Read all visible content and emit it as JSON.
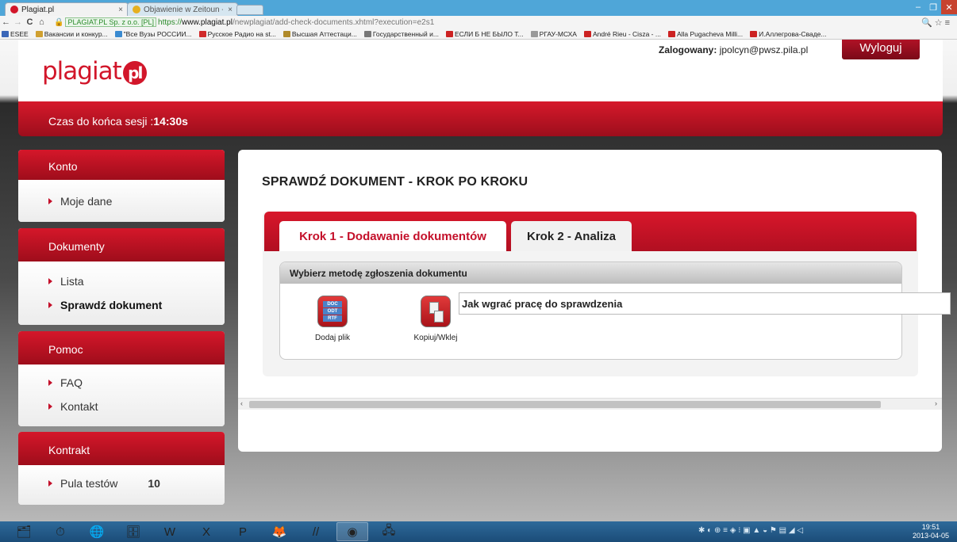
{
  "browser": {
    "tabs": [
      {
        "title": "Plagiat.pl",
        "close": "×"
      },
      {
        "title": "Objawienie w Zeitoun - St",
        "close": "×"
      }
    ],
    "window_controls": {
      "minimize": "–",
      "maximize": "❐",
      "close": "✕"
    },
    "nav": {
      "back": "←",
      "forward": "→",
      "reload": "C",
      "home": "⌂"
    },
    "address": {
      "org_label": "PLAGIAT.PL Sp. z o.o. [PL]",
      "scheme": "https://",
      "host": "www.plagiat.pl",
      "path": "/newplagiat/add-check-documents.xhtml?execution=e2s1"
    },
    "address_right": "🔍☆≡",
    "bookmarks": [
      {
        "label": "ESEE",
        "color": "#3a66b8"
      },
      {
        "label": "Вакансии и конкур...",
        "color": "#d0a030"
      },
      {
        "label": "\"Все Вузы РОССИИ...",
        "color": "#3a8ad0"
      },
      {
        "label": "Русское Радио на st...",
        "color": "#d02a2a"
      },
      {
        "label": "Высшая Аттестаци...",
        "color": "#b08a2a"
      },
      {
        "label": "Государственный и...",
        "color": "#777777"
      },
      {
        "label": "ЕСЛИ Б НЕ БЫЛО Т...",
        "color": "#cc2222"
      },
      {
        "label": "РГАУ-МСХА",
        "color": "#999999"
      },
      {
        "label": "André Rieu - Cisza - ...",
        "color": "#cc2222"
      },
      {
        "label": "Alla Pugacheva Milli...",
        "color": "#cc2222"
      },
      {
        "label": "И.Аллегрова-Сваде...",
        "color": "#cc2222"
      }
    ]
  },
  "header": {
    "logo_text": "plagiat",
    "logo_badge": "pl",
    "login_label": "Zalogowany:",
    "login_user": "jpolcyn@pwsz.pila.pl",
    "logout_label": "Wyloguj"
  },
  "session": {
    "label": "Czas do końca sesji :",
    "time": "14:30s"
  },
  "sidebar": {
    "konto": {
      "title": "Konto",
      "items": [
        "Moje dane"
      ]
    },
    "dokumenty": {
      "title": "Dokumenty",
      "items": [
        "Lista",
        "Sprawdź dokument"
      ]
    },
    "pomoc": {
      "title": "Pomoc",
      "items": [
        "FAQ",
        "Kontakt"
      ]
    },
    "kontrakt": {
      "title": "Kontrakt",
      "pool_label": "Pula testów",
      "pool_count": "10"
    }
  },
  "main": {
    "title": "SPRAWDŹ DOKUMENT - KROK PO KROKU",
    "tabs": [
      "Krok 1 - Dodawanie dokumentów",
      "Krok 2 - Analiza"
    ],
    "method_header": "Wybierz metodę zgłoszenia dokumentu",
    "methods": [
      {
        "label": "Dodaj plik",
        "formats": [
          "DOC",
          "ODT",
          "RTF"
        ]
      },
      {
        "label": "Kopiuj/Wklej"
      }
    ],
    "howto": "Jak wgrać pracę do sprawdzenia"
  },
  "scrollbar": {
    "left": "‹",
    "right": "›"
  },
  "taskbar": {
    "apps": [
      "🗂",
      "⏱",
      "🌐",
      "🗄",
      "W",
      "X",
      "P",
      "🦊",
      "//",
      "◉",
      "🖧"
    ],
    "tray": "✱ ◐ ⊕ ≡ ◈ ⁝ ▣ ▲ ◒ ⚑ ▤ ◢ ◁",
    "time": "19:51",
    "date": "2013-04-05"
  },
  "colors": {
    "brand_red": "#c4102a",
    "taskbar": "#1b4c78",
    "chrome_blue": "#4fa6d8"
  }
}
